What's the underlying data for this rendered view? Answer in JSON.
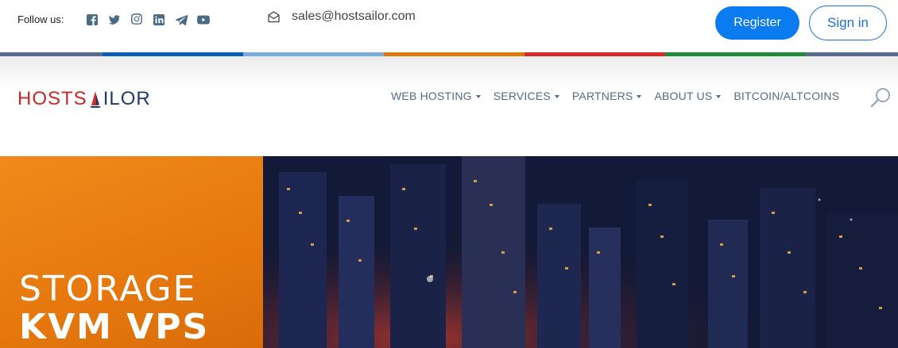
{
  "topbar": {
    "follow_label": "Follow us:",
    "socials": [
      {
        "icon": "facebook-icon"
      },
      {
        "icon": "twitter-icon"
      },
      {
        "icon": "instagram-icon"
      },
      {
        "icon": "linkedin-icon"
      },
      {
        "icon": "telegram-icon"
      },
      {
        "icon": "youtube-icon"
      }
    ],
    "email": "sales@hostsailor.com",
    "register_label": "Register",
    "signin_label": "Sign in"
  },
  "strip_colors": [
    "#5a6b8c",
    "#0a5fb4",
    "#7aaed8",
    "#d97a0a",
    "#d42a2a",
    "#1e8a3a",
    "#5a6b8c"
  ],
  "brand": {
    "logo_left": "HOSTS",
    "logo_right": "ILOR",
    "primary_color": "#c62828",
    "secondary_color": "#1c3a6a"
  },
  "nav": {
    "items": [
      {
        "label": "WEB HOSTING",
        "dropdown": true
      },
      {
        "label": "SERVICES",
        "dropdown": true
      },
      {
        "label": "PARTNERS",
        "dropdown": true
      },
      {
        "label": "ABOUT US",
        "dropdown": true
      },
      {
        "label": "BITCOIN/ALTCOINS",
        "dropdown": false
      }
    ]
  },
  "hero": {
    "title_line1": "STORAGE",
    "title_line2": "KVM VPS"
  }
}
